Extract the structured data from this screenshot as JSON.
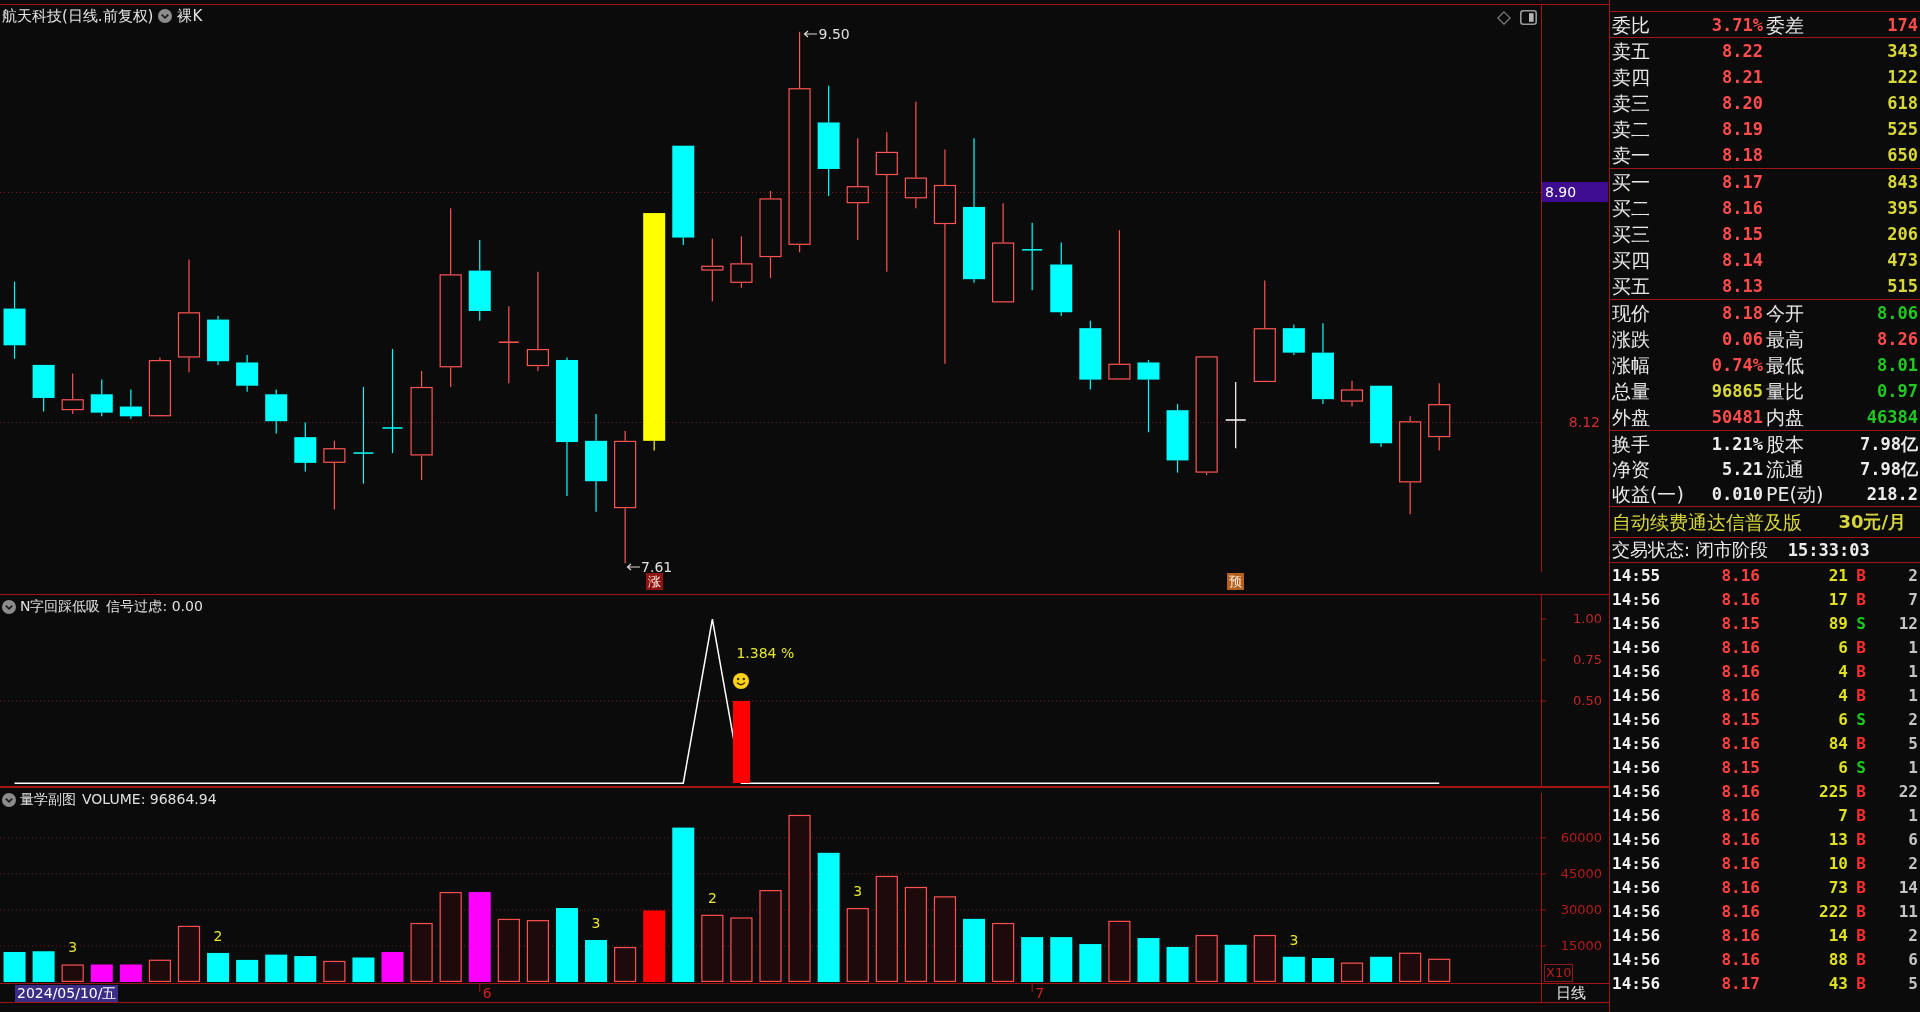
{
  "main_chart": {
    "title": "航天科技(日线.前复权)",
    "template": "裸K",
    "high_marker": "9.50",
    "low_marker": "7.61",
    "price_labels": [
      {
        "text": "8.90",
        "highlighted": true
      },
      {
        "text": "8.12",
        "highlighted": false
      }
    ],
    "signal_tags": [
      {
        "text": "涨",
        "color": "#8e1414"
      },
      {
        "text": "预",
        "color": "#b4601e"
      }
    ]
  },
  "indicator_panel": {
    "title": "N字回踩低吸",
    "reading": "信号过虑: 0.00",
    "signal_label": "1.384 %",
    "chart_data": {
      "type": "line",
      "ylim": [
        -0.02,
        1.15
      ],
      "yticks": [
        {
          "value": 0.5,
          "label": "0.50"
        },
        {
          "value": 0.75,
          "label": "0.75"
        },
        {
          "value": 1,
          "label": "1.00"
        }
      ],
      "series": [
        {
          "color": "#ffffff",
          "values": [
            0,
            0,
            0,
            0,
            0,
            0,
            0,
            0,
            0,
            0,
            0,
            0,
            0,
            0,
            0,
            0,
            0,
            0,
            0,
            0,
            0,
            0,
            0,
            0,
            1,
            0,
            0,
            0,
            0,
            0,
            0,
            0,
            0,
            0,
            0,
            0,
            0,
            0,
            0,
            0,
            0,
            0,
            0,
            0,
            0,
            0,
            0,
            0,
            0,
            0
          ]
        }
      ]
    }
  },
  "volume_panel": {
    "title": "量学副图",
    "reading": "VOLUME: 96864.94",
    "multiplier": "X10",
    "bars": [
      {
        "color": "#00ffff",
        "hollow": false
      },
      {
        "color": "#00ffff",
        "hollow": false
      },
      {
        "color": "#ff5050",
        "hollow": true
      },
      {
        "color": "#ff00ff",
        "hollow": false
      },
      {
        "color": "#ff00ff",
        "hollow": false
      },
      {
        "color": "#ff5050",
        "hollow": true
      },
      {
        "color": "#ff5050",
        "hollow": true
      },
      {
        "color": "#00ffff",
        "hollow": false
      },
      {
        "color": "#00ffff",
        "hollow": false
      },
      {
        "color": "#00ffff",
        "hollow": false
      },
      {
        "color": "#00ffff",
        "hollow": false
      },
      {
        "color": "#ff5050",
        "hollow": true
      },
      {
        "color": "#00ffff",
        "hollow": false
      },
      {
        "color": "#ff00ff",
        "hollow": false
      },
      {
        "color": "#ff5050",
        "hollow": true
      },
      {
        "color": "#ff5050",
        "hollow": true
      },
      {
        "color": "#ff00ff",
        "hollow": false
      },
      {
        "color": "#ff5050",
        "hollow": true
      },
      {
        "color": "#ff5050",
        "hollow": true
      },
      {
        "color": "#00ffff",
        "hollow": false
      },
      {
        "color": "#00ffff",
        "hollow": false
      },
      {
        "color": "#ff5050",
        "hollow": true
      },
      {
        "color": "#ff0000",
        "hollow": false
      },
      {
        "color": "#00ffff",
        "hollow": false
      },
      {
        "color": "#ff5050",
        "hollow": true
      },
      {
        "color": "#ff5050",
        "hollow": true
      },
      {
        "color": "#ff5050",
        "hollow": true
      },
      {
        "color": "#ff5050",
        "hollow": true
      },
      {
        "color": "#00ffff",
        "hollow": false
      },
      {
        "color": "#ff5050",
        "hollow": true
      },
      {
        "color": "#ff5050",
        "hollow": true
      },
      {
        "color": "#ff5050",
        "hollow": true
      },
      {
        "color": "#ff5050",
        "hollow": true
      },
      {
        "color": "#00ffff",
        "hollow": false
      },
      {
        "color": "#ff5050",
        "hollow": true
      },
      {
        "color": "#00ffff",
        "hollow": false
      },
      {
        "color": "#00ffff",
        "hollow": false
      },
      {
        "color": "#00ffff",
        "hollow": false
      },
      {
        "color": "#ff5050",
        "hollow": true
      },
      {
        "color": "#00ffff",
        "hollow": false
      },
      {
        "color": "#00ffff",
        "hollow": false
      },
      {
        "color": "#ff5050",
        "hollow": true
      },
      {
        "color": "#00ffff",
        "hollow": false
      },
      {
        "color": "#ff5050",
        "hollow": true
      },
      {
        "color": "#00ffff",
        "hollow": false
      },
      {
        "color": "#00ffff",
        "hollow": false
      },
      {
        "color": "#ff5050",
        "hollow": true
      },
      {
        "color": "#00ffff",
        "hollow": false
      },
      {
        "color": "#ff5050",
        "hollow": true
      },
      {
        "color": "#ff5050",
        "hollow": true
      }
    ],
    "chart_data": {
      "type": "bar",
      "ylim": [
        0,
        81000
      ],
      "yticks": [
        15000,
        30000,
        45000,
        60000
      ],
      "grid": true,
      "series": [
        {
          "values": [
            12500,
            12800,
            7300,
            7300,
            7300,
            9300,
            23400,
            12100,
            9200,
            11400,
            10800,
            8800,
            10200,
            12500,
            24600,
            37500,
            37500,
            26300,
            25800,
            30800,
            17500,
            14600,
            29800,
            64300,
            28000,
            26900,
            38300,
            69600,
            53800,
            30800,
            44200,
            39600,
            35700,
            26300,
            24600,
            18700,
            18700,
            15800,
            25500,
            18300,
            14600,
            19600,
            15500,
            19600,
            10500,
            10000,
            8100,
            10500,
            12200,
            9700,
            null,
            null,
            null
          ]
        }
      ],
      "annotations": [
        "3",
        "2",
        "3",
        "2",
        "3",
        "3"
      ]
    }
  },
  "time_axis": {
    "cursor_date": "2024/05/10/五",
    "month_marks": [
      {
        "text": "6"
      },
      {
        "text": "7"
      }
    ],
    "period": "日线"
  },
  "quote_panel": {
    "order_ratio": [
      {
        "label": "委比",
        "value": "3.71%",
        "color": "#ff4c4c"
      },
      {
        "label": "委差",
        "value": "174",
        "color": "#ff4c4c"
      }
    ],
    "asks": [
      {
        "label": "卖五",
        "price": "8.22",
        "volume": "343"
      },
      {
        "label": "卖四",
        "price": "8.21",
        "volume": "122"
      },
      {
        "label": "卖三",
        "price": "8.20",
        "volume": "618"
      },
      {
        "label": "卖二",
        "price": "8.19",
        "volume": "525"
      },
      {
        "label": "卖一",
        "price": "8.18",
        "volume": "650"
      }
    ],
    "bids": [
      {
        "label": "买一",
        "price": "8.17",
        "volume": "843"
      },
      {
        "label": "买二",
        "price": "8.16",
        "volume": "395"
      },
      {
        "label": "买三",
        "price": "8.15",
        "volume": "206"
      },
      {
        "label": "买四",
        "price": "8.14",
        "volume": "473"
      },
      {
        "label": "买五",
        "price": "8.13",
        "volume": "515"
      }
    ],
    "stats": [
      {
        "label": "现价",
        "value": "8.18",
        "color": "#ff4c4c"
      },
      {
        "label": "今开",
        "value": "8.06",
        "color": "#22c722"
      },
      {
        "label": "涨跌",
        "value": "0.06",
        "color": "#ff4c4c"
      },
      {
        "label": "最高",
        "value": "8.26",
        "color": "#ff4c4c"
      },
      {
        "label": "涨幅",
        "value": "0.74%",
        "color": "#ff4c4c"
      },
      {
        "label": "最低",
        "value": "8.01",
        "color": "#22c722"
      },
      {
        "label": "总量",
        "value": "96865",
        "color": "#d8d838"
      },
      {
        "label": "量比",
        "value": "0.97",
        "color": "#22c722"
      },
      {
        "label": "外盘",
        "value": "50481",
        "color": "#ff4c4c"
      },
      {
        "label": "内盘",
        "value": "46384",
        "color": "#22c722"
      }
    ],
    "fundamentals": [
      {
        "label": "换手",
        "value": "1.21%"
      },
      {
        "label": "股本",
        "value": "7.98亿"
      },
      {
        "label": "净资",
        "value": "5.21"
      },
      {
        "label": "流通",
        "value": "7.98亿"
      },
      {
        "label": "收益(一)",
        "value": "0.010"
      },
      {
        "label": "PE(动)",
        "value": "218.2"
      }
    ],
    "promo": {
      "text": "自动续费通达信普及版",
      "price": "30元/月"
    },
    "status": {
      "text": "交易状态: 闭市阶段",
      "time": "15:33:03"
    },
    "ticks": [
      {
        "time": "14:55",
        "price": "8.16",
        "volume": "21",
        "side": "B",
        "color": "#ff3030",
        "count": "2"
      },
      {
        "time": "14:56",
        "price": "8.16",
        "volume": "17",
        "side": "B",
        "color": "#ff3030",
        "count": "7"
      },
      {
        "time": "14:56",
        "price": "8.15",
        "volume": "89",
        "side": "S",
        "color": "#1ec81e",
        "count": "12"
      },
      {
        "time": "14:56",
        "price": "8.16",
        "volume": "6",
        "side": "B",
        "color": "#ff3030",
        "count": "1"
      },
      {
        "time": "14:56",
        "price": "8.16",
        "volume": "4",
        "side": "B",
        "color": "#ff3030",
        "count": "1"
      },
      {
        "time": "14:56",
        "price": "8.16",
        "volume": "4",
        "side": "B",
        "color": "#ff3030",
        "count": "1"
      },
      {
        "time": "14:56",
        "price": "8.15",
        "volume": "6",
        "side": "S",
        "color": "#1ec81e",
        "count": "2"
      },
      {
        "time": "14:56",
        "price": "8.16",
        "volume": "84",
        "side": "B",
        "color": "#ff3030",
        "count": "5"
      },
      {
        "time": "14:56",
        "price": "8.15",
        "volume": "6",
        "side": "S",
        "color": "#1ec81e",
        "count": "1"
      },
      {
        "time": "14:56",
        "price": "8.16",
        "volume": "225",
        "side": "B",
        "color": "#ff3030",
        "count": "22"
      },
      {
        "time": "14:56",
        "price": "8.16",
        "volume": "7",
        "side": "B",
        "color": "#ff3030",
        "count": "1"
      },
      {
        "time": "14:56",
        "price": "8.16",
        "volume": "13",
        "side": "B",
        "color": "#ff3030",
        "count": "6"
      },
      {
        "time": "14:56",
        "price": "8.16",
        "volume": "10",
        "side": "B",
        "color": "#ff3030",
        "count": "2"
      },
      {
        "time": "14:56",
        "price": "8.16",
        "volume": "73",
        "side": "B",
        "color": "#ff3030",
        "count": "14"
      },
      {
        "time": "14:56",
        "price": "8.16",
        "volume": "222",
        "side": "B",
        "color": "#ff3030",
        "count": "11"
      },
      {
        "time": "14:56",
        "price": "8.16",
        "volume": "14",
        "side": "B",
        "color": "#ff3030",
        "count": "2"
      },
      {
        "time": "14:56",
        "price": "8.16",
        "volume": "88",
        "side": "B",
        "color": "#ff3030",
        "count": "6"
      },
      {
        "time": "14:56",
        "price": "8.17",
        "volume": "43",
        "side": "B",
        "color": "#ff3030",
        "count": "5"
      }
    ]
  }
}
